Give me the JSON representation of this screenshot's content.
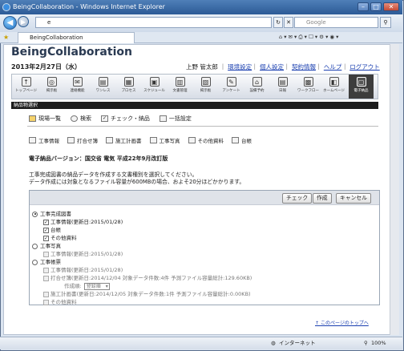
{
  "window": {
    "title": "BeingCollaboration - Windows Internet Explorer",
    "minimize_glyph": "–",
    "maximize_glyph": "□",
    "close_glyph": "✕"
  },
  "browser": {
    "address_prefix": "e",
    "search_placeholder": "Google",
    "tab_label": "BeingCollaboration",
    "back_glyph": "◀",
    "forward_glyph": "▶"
  },
  "app": {
    "title": "BeingCollaboration",
    "date": "2013年2月27日（水）",
    "user_name": "上野 管太郎",
    "links": [
      "環境設定",
      "個人設定",
      "契約情報",
      "ヘルプ",
      "ログアウト"
    ]
  },
  "toolbar": {
    "items": [
      {
        "label": "トップページ",
        "icon": "up-arrow-icon",
        "glyph": "↑"
      },
      {
        "label": "掲示板",
        "icon": "board-icon",
        "glyph": "◎"
      },
      {
        "label": "連絡機能",
        "icon": "mail-icon",
        "glyph": "✉"
      },
      {
        "label": "ワンレス",
        "icon": "workflow-icon",
        "glyph": "▤"
      },
      {
        "label": "プロセス",
        "icon": "process-icon",
        "glyph": "▦"
      },
      {
        "label": "スケジュール",
        "icon": "calendar-icon",
        "glyph": "▣"
      },
      {
        "label": "文書管理",
        "icon": "document-icon",
        "glyph": "▥"
      },
      {
        "label": "掲示板",
        "icon": "notice-icon",
        "glyph": "▧"
      },
      {
        "label": "アンケート",
        "icon": "survey-icon",
        "glyph": "✎"
      },
      {
        "label": "設備予約",
        "icon": "facility-icon",
        "glyph": "⌂"
      },
      {
        "label": "日報",
        "icon": "report-icon",
        "glyph": "▤"
      },
      {
        "label": "ワークフロー",
        "icon": "flow-icon",
        "glyph": "▩"
      },
      {
        "label": "ホームページ",
        "icon": "homepage-icon",
        "glyph": "◧"
      },
      {
        "label": "電子納品",
        "icon": "delivery-icon",
        "glyph": "▢",
        "active": true
      }
    ]
  },
  "section": {
    "title": "納品物選択"
  },
  "subnav": [
    "現場一覧",
    "検索",
    "チェック・納品",
    "一括設定"
  ],
  "doc_tabs": [
    "工事情報",
    "打合せ簿",
    "施工計画書",
    "工事写真",
    "その他資料",
    "台帳"
  ],
  "version_text": "電子納品バージョン：国交省 電気 平成22年9月改訂版",
  "description": [
    "工事完成図書の納品データを作成する文書種別を選択してください。",
    "データ作成には対象となるファイル容量が600MBの場合、およそ20分ほどかかります。"
  ],
  "buttons": {
    "check": "チェック",
    "create": "作成",
    "cancel": "キャンセル"
  },
  "options": {
    "completion": {
      "label": "工事完成図書",
      "items": [
        {
          "label": "工事情報(更新日:2015/01/28)",
          "checked": true
        },
        {
          "label": "台帳",
          "checked": true
        },
        {
          "label": "その他資料",
          "checked": true
        }
      ]
    },
    "photos": {
      "label": "工事写真",
      "items": [
        {
          "label": "工事情報(更新日:2015/01/28)",
          "checked": false
        }
      ]
    },
    "documents": {
      "label": "工事帳票",
      "items": [
        {
          "label": "工事情報(更新日:2015/01/28)",
          "checked": false
        },
        {
          "label": "打合せ簿(更新日:2014/12/04 対象データ件数:4件 予測ファイル容量総計:129.60KB)",
          "checked": false
        },
        {
          "label": "施工計画書(更新日:2014/12/05 対象データ件数:1件 予測ファイル容量総計:0.00KB)",
          "checked": false
        },
        {
          "label": "その他資料",
          "checked": false
        }
      ],
      "creator_label": "作成順:",
      "creator_value": "登録順"
    }
  },
  "page_top_link": "このページのトップへ",
  "statusbar": {
    "zone": "インターネット",
    "zoom": "100%"
  }
}
